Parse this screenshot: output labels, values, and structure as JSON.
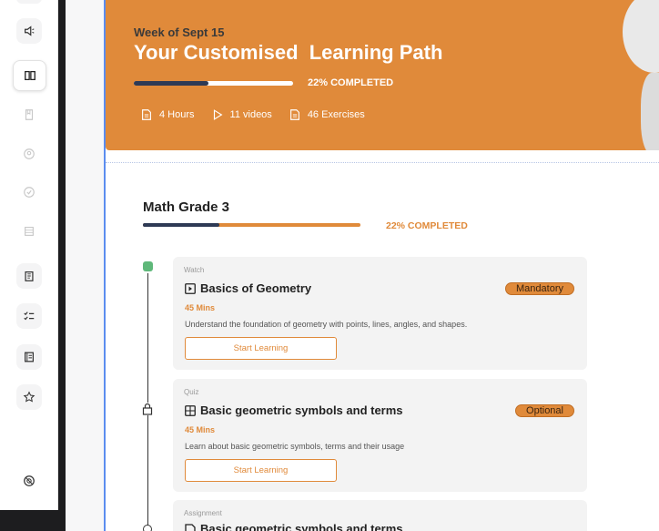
{
  "sidebar": {
    "items": [
      {
        "icon": "megaphone-icon"
      },
      {
        "icon": "book-open-icon",
        "active": true
      },
      {
        "icon": "bookmark-icon"
      },
      {
        "icon": "user-circle-icon"
      },
      {
        "icon": "check-circle-icon"
      },
      {
        "icon": "list-icon"
      },
      {
        "icon": "clipboard-icon"
      },
      {
        "icon": "checklist-icon"
      },
      {
        "icon": "notebook-icon"
      },
      {
        "icon": "star-icon"
      },
      {
        "icon": "support-icon"
      }
    ]
  },
  "banner": {
    "week": "Week of Sept 15",
    "title": "Your Customised  Learning Path",
    "progress_fraction": 0.47,
    "pct_label": "22% COMPLETED",
    "stats": [
      {
        "icon": "document-icon",
        "label": "4 Hours"
      },
      {
        "icon": "play-icon",
        "label": "11 videos"
      },
      {
        "icon": "document-icon",
        "label": "46 Exercises"
      }
    ],
    "color": "#e08a3a"
  },
  "course": {
    "title": "Math Grade 3",
    "progress_fraction": 0.35,
    "pct_label": "22% COMPLETED"
  },
  "cards": [
    {
      "type": "Watch",
      "icon": "play-square-icon",
      "title": "Basics of Geometry",
      "tag": "Mandatory",
      "mins": "45 Mins",
      "desc": "Understand the foundation of geometry with points, lines, angles, and shapes.",
      "button": "Start Learning"
    },
    {
      "type": "Quiz",
      "icon": "grid-square-icon",
      "title": "Basic geometric symbols and terms",
      "tag": "Optional",
      "mins": "45 Mins",
      "desc": "Learn about basic geometric symbols, terms and their usage",
      "button": "Start Learning"
    },
    {
      "type": "Assignment",
      "icon": "document-edit-icon",
      "title": "Basic geometric symbols and terms"
    }
  ]
}
